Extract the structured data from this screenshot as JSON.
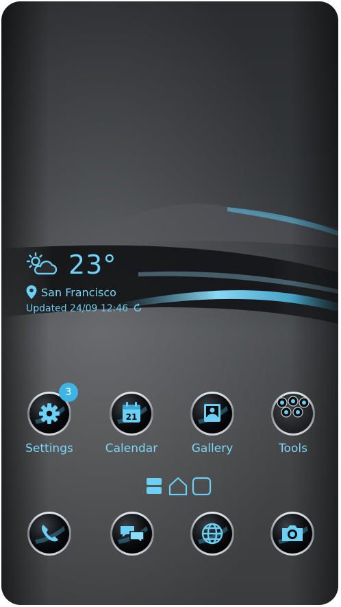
{
  "weather": {
    "temperature": "23°",
    "location": "San Francisco",
    "updated": "Updated 24/09 12:46"
  },
  "apps": [
    {
      "label": "Settings",
      "icon": "settings-gear-icon",
      "badge": "3"
    },
    {
      "label": "Calendar",
      "icon": "calendar-icon",
      "day": "21"
    },
    {
      "label": "Gallery",
      "icon": "gallery-icon"
    },
    {
      "label": "Tools",
      "icon": "tools-folder-icon"
    }
  ],
  "dock": [
    {
      "icon": "phone-icon"
    },
    {
      "icon": "messages-icon"
    },
    {
      "icon": "browser-globe-icon"
    },
    {
      "icon": "camera-icon"
    }
  ],
  "pager": {
    "icons": [
      "menu-page-icon",
      "home-page-icon",
      "blank-page-icon"
    ]
  },
  "colors": {
    "accent": "#6ccff6",
    "badge": "#3db4e4",
    "background": "#3a3c3e"
  }
}
